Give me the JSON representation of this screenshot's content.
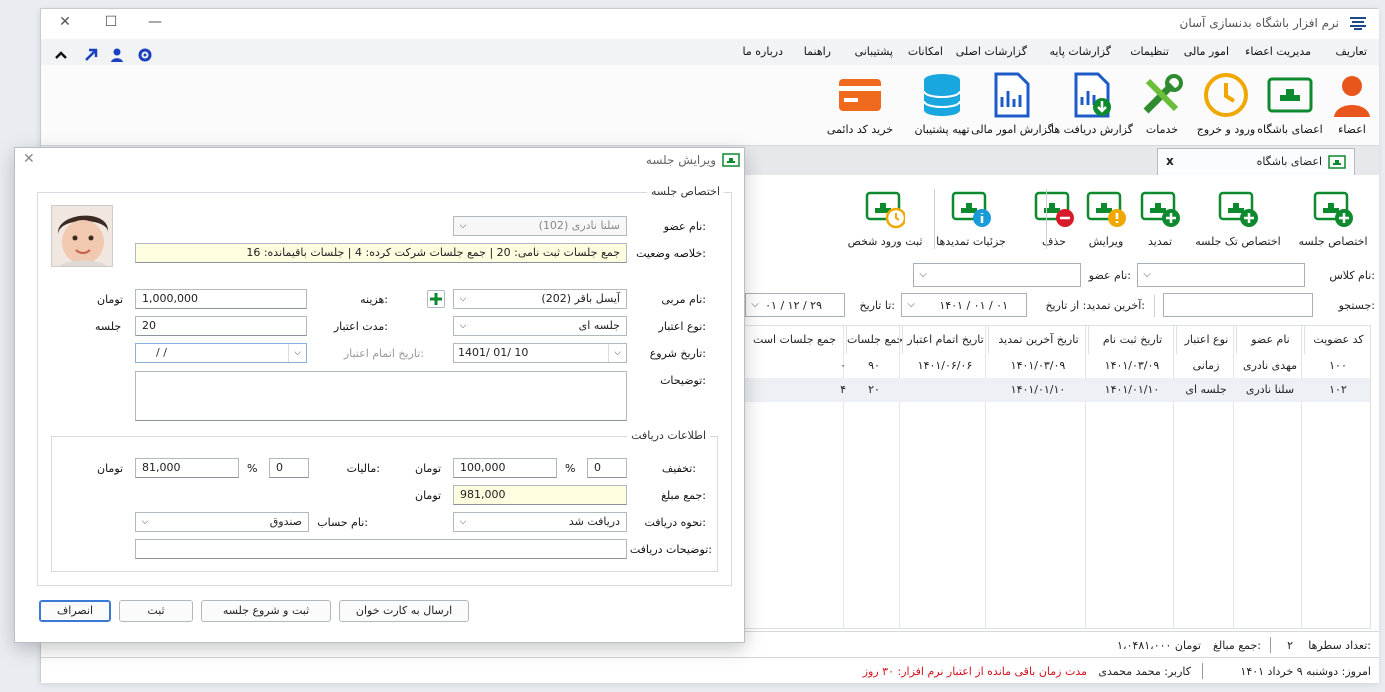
{
  "window": {
    "title": "نرم افزار باشگاه بدنسازی آسان"
  },
  "menu": [
    "تعاریف",
    "مدیریت اعضاء",
    "امور مالی",
    "تنظیمات",
    "گزارشات پایه",
    "گزارشات اصلی",
    "امکانات",
    "پشتیبانی",
    "راهنما",
    "درباره ما"
  ],
  "ribbon": [
    "اعضاء",
    "اعضای باشگاه",
    "ورود و خروج",
    "خدمات",
    "گزارش دریافت ها",
    "گزارش امور مالی",
    "تهیه پشتیبان",
    "خرید کد دائمی"
  ],
  "doc_tab": {
    "label": "اعضای باشگاه",
    "close": "x"
  },
  "toolbar": [
    "اختصاص جلسه",
    "اختصاص تک جلسه",
    "تمدید",
    "ویرایش",
    "حذف",
    "جزئیات تمدیدها",
    "ثبت ورود شخص"
  ],
  "filters": {
    "class_label": "نام کلاس:",
    "member_label": "نام عضو:",
    "search_label": "جستجو:",
    "renew_label": "آخرین تمدید: از تاریخ:",
    "from_date": "۱۴۰۱ / ۰۱ / ۰۱",
    "to_label": "تا تاریخ:",
    "to_date": "۰۱ / ۱۲ / ۲۹"
  },
  "table": {
    "headers": [
      "کد عضویت",
      "نام عضو",
      "نوع اعتبار",
      "تاریخ ثبت نام",
      "تاریخ آخرین تمدید",
      "تاریخ اتمام اعتبار",
      "جمع جلسات",
      "جمع جلسات است"
    ],
    "rows": [
      [
        "۱۰۰",
        "مهدی نادری",
        "زمانی",
        "۱۴۰۱/۰۳/۰۹",
        "۱۴۰۱/۰۳/۰۹",
        "۱۴۰۱/۰۶/۰۶",
        "۹۰",
        "۰"
      ],
      [
        "۱۰۲",
        "سلنا نادری",
        "جلسه ای",
        "۱۴۰۱/۰۱/۱۰",
        "۱۴۰۱/۰۱/۱۰",
        "",
        "۲۰",
        "۴"
      ]
    ]
  },
  "summary": {
    "rows_label": "تعداد سطرها:",
    "rows": "۲",
    "sum_label": "جمع مبالغ:",
    "sum": "۱،۰۴۸۱،۰۰۰ تومان"
  },
  "status": {
    "today": "امروز: دوشنبه ۹ خرداد ۱۴۰۱",
    "user": "کاربر: محمد محمدی",
    "remaining": "مدت زمان باقی مانده از اعتبار نرم افزار: ۳۰ روز"
  },
  "dialog": {
    "title": "ویرایش جلسه",
    "group1": "اختصاص جلسه",
    "member_label": "نام عضو:",
    "member_value": "سلنا نادری (102)",
    "summary_label": "خلاصه وضعیت:",
    "summary_value": "جمع جلسات ثبت نامی: 20  |  جمع جلسات شرکت کرده: 4  |  جلسات باقیمانده: 16",
    "coach_label": "نام مربی:",
    "coach_value": "آیسل باقر (202)",
    "cost_label": "هزینه:",
    "cost_value": "1,000,000",
    "cost_unit": "تومان",
    "credit_type_label": "نوع اعتبار:",
    "credit_type_value": "جلسه ای",
    "validity_label": "مدت اعتبار:",
    "validity_value": "20",
    "validity_unit": "جلسه",
    "start_label": "تاریخ شروع:",
    "start_value": "1401/ 01/ 10",
    "end_label": "تاریخ اتمام اعتبار:",
    "end_value": "/     /",
    "desc_label": "توضیحات:",
    "group2": "اطلاعات دریافت",
    "discount_label": "تخفیف:",
    "discount_pct": "0",
    "discount_amount": "100,000",
    "discount_unit": "تومان",
    "tax_label": "مالیات:",
    "tax_pct": "0",
    "tax_amount": "81,000",
    "tax_unit": "تومان",
    "total_label": "جمع مبلغ:",
    "total_value": "981,000",
    "total_unit": "تومان",
    "method_label": "نحوه دریافت:",
    "method_value": "دریافت شد",
    "account_label": "نام حساب:",
    "account_value": "صندوق",
    "pay_desc_label": "توضیحات دریافت:",
    "pct": "%",
    "buttons": {
      "send": "ارسال به کارت خوان",
      "save_start": "ثبت و شروع جلسه",
      "save": "ثبت",
      "cancel": "انصراف"
    }
  }
}
